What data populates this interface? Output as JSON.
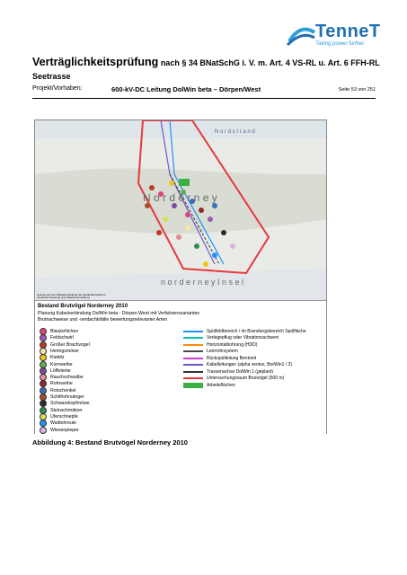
{
  "header": {
    "logo_word": "TenneT",
    "logo_tagline": "Taking power further",
    "title_part1": "Verträglichkeitsprüfung",
    "title_part2": " nach § 34 BNatSchG i. V. m. Art. 4 VS-RL u. Art. 6 FFH-RL Seetrasse",
    "project_label": "Projekt/Vorhaben:",
    "project_value": "600-kV-DC Leitung DolWin beta – Dörpen/West",
    "page": "Seite 53 von 251"
  },
  "figure": {
    "map_label_nordstrand": "N o r d s t r a n d",
    "map_label_island": "N o r d e r n e y",
    "map_label_insel": "n o r d e r n e y   I n s e l",
    "extract_note": "Auszug aus der Rasterdarstellung der Niedersächsischen Landesvermessung und Katasterverwaltung",
    "legend_title": "Bestand Brutvögel Norderney 2010",
    "legend_sub1": "Planung Kabelverbindung DolWin beta - Dörpen West mit Verfahrensvarianten",
    "legend_sub2": "Brutnachweise und -verdachtsfälle bewertungsrelevanter Arten",
    "species": [
      {
        "name": "Blaukehlchen",
        "color": "#e0457b"
      },
      {
        "name": "Feldschwirl",
        "color": "#9b59b6"
      },
      {
        "name": "Großer Brachvogel",
        "color": "#c0392b"
      },
      {
        "name": "Heringsmöwe",
        "color": "#f5e6a8"
      },
      {
        "name": "Kiebitz",
        "color": "#f0c419"
      },
      {
        "name": "Kornweihe",
        "color": "#5fb04a"
      },
      {
        "name": "Löffelente",
        "color": "#7b4fa0"
      },
      {
        "name": "Rauchschwalbe",
        "color": "#e88a9a"
      },
      {
        "name": "Rohrweihe",
        "color": "#8e2a2a"
      },
      {
        "name": "Rotschenkel",
        "color": "#3a6fb8"
      },
      {
        "name": "Schilfrohrsänger",
        "color": "#a0522d"
      },
      {
        "name": "Schwarzkopfmöwe",
        "color": "#2c2c2c"
      },
      {
        "name": "Steinschmätzer",
        "color": "#2e8b57"
      },
      {
        "name": "Uferschnepfe",
        "color": "#d4e157"
      },
      {
        "name": "Waldohreule",
        "color": "#1e90ff"
      },
      {
        "name": "Wiesenpieper",
        "color": "#d8b4e2"
      }
    ],
    "lines": [
      {
        "name": "Spülfeldbereich / im Brandungsbereich Spülfläche",
        "color": "#1e90ff"
      },
      {
        "name": "Verlegepflug oder Vibrationsschwert",
        "color": "#00bfbf"
      },
      {
        "name": "Horizontalbohrung (HDD)",
        "color": "#ff8c00"
      },
      {
        "name": "Leerrohrsystem",
        "color": "#4a4a4a"
      },
      {
        "name": "Rückspülleitung Bentonit",
        "color": "#d63ad6"
      },
      {
        "name": "Kabelleitungen (alpha ventus, BorWin1 / 2)",
        "color": "#6a5acd"
      },
      {
        "name": "Trassenachse DolWin 1 (geplant)",
        "color": "#333333"
      },
      {
        "name": "Untersuchungsraum Brutvögel (500 m)",
        "color": "#e8383d"
      },
      {
        "name": "Arbeitsflächen",
        "color": "#3cb043"
      }
    ],
    "colors": {
      "boundary": "#e8383d",
      "logo": "#1f6fb5"
    }
  },
  "caption": "Abbildung 4: Bestand Brutvögel Norderney 2010"
}
